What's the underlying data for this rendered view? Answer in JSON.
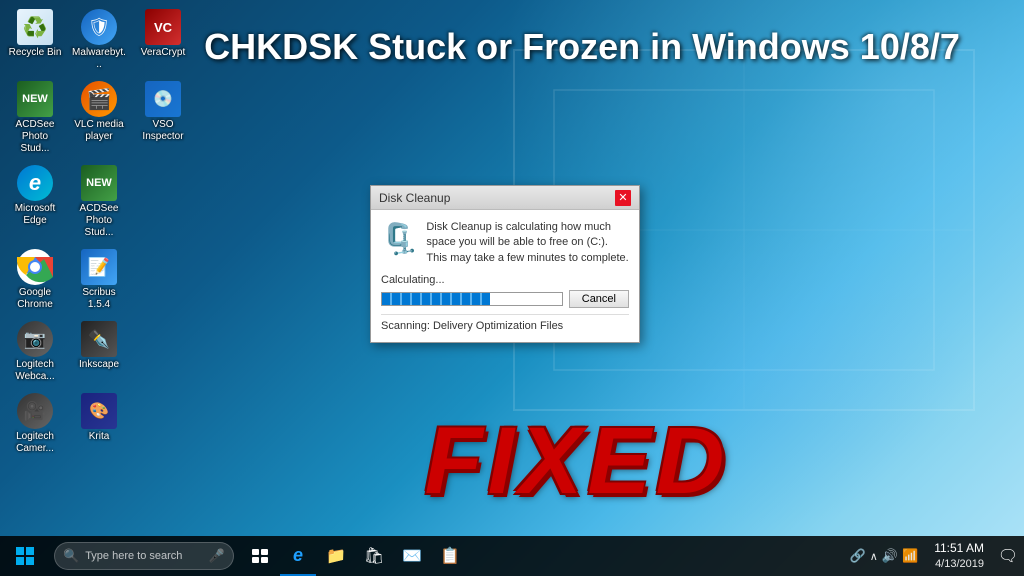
{
  "desktop": {
    "background": "Windows 10 desktop",
    "title": "CHKDSK Stuck or Frozen in Windows 10/8/7",
    "fixed_label": "FIXED"
  },
  "icons": [
    {
      "id": "recycle-bin",
      "label": "Recycle Bin",
      "type": "recycle"
    },
    {
      "id": "malwarebytes",
      "label": "Malwarebyt...",
      "type": "malware"
    },
    {
      "id": "veracrypt",
      "label": "VeraCrypt",
      "type": "vera"
    },
    {
      "id": "acdsee-photo",
      "label": "ACDSee Photo Stud...",
      "type": "acd"
    },
    {
      "id": "vlc",
      "label": "VLC media player",
      "type": "vlc"
    },
    {
      "id": "vso",
      "label": "VSO Inspector",
      "type": "vso"
    },
    {
      "id": "microsoft-edge",
      "label": "Microsoft Edge",
      "type": "edge"
    },
    {
      "id": "acdsee-photo2",
      "label": "ACDSee Photo Stud...",
      "type": "acd"
    },
    {
      "id": "google-chrome",
      "label": "Google Chrome",
      "type": "chrome"
    },
    {
      "id": "scribus",
      "label": "Scribus 1.5.4",
      "type": "scribus"
    },
    {
      "id": "logitech-webcam",
      "label": "Logitech Webca...",
      "type": "cam"
    },
    {
      "id": "inkscape",
      "label": "Inkscape",
      "type": "inkscape"
    },
    {
      "id": "logitech-camera",
      "label": "Logitech Camer...",
      "type": "cam2"
    },
    {
      "id": "krita",
      "label": "Krita",
      "type": "krita"
    }
  ],
  "dialog": {
    "title": "Disk Cleanup",
    "message": "Disk Cleanup is calculating how much space you will be able to free on  (C:). This may take a few minutes to complete.",
    "calculating_label": "Calculating...",
    "cancel_label": "Cancel",
    "scanning_label": "Scanning:  Delivery Optimization Files",
    "progress_percent": 60
  },
  "taskbar": {
    "search_placeholder": "Type here to search",
    "time": "11:51 AM",
    "date": "4/13/2019"
  }
}
